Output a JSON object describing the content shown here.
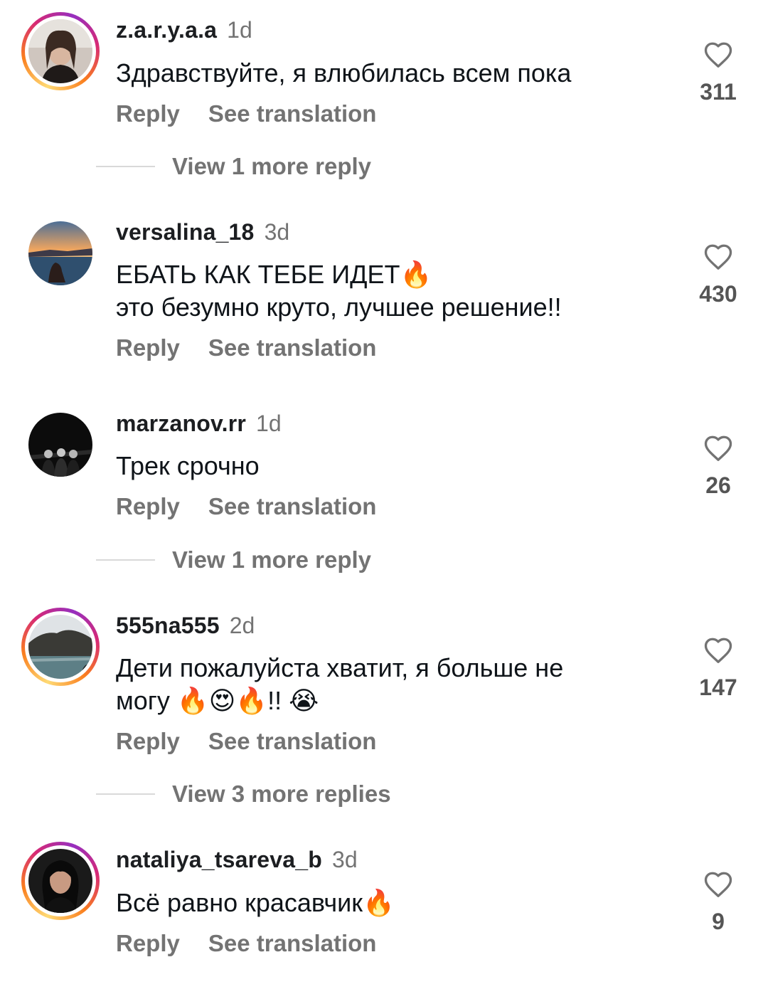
{
  "comments": [
    {
      "username": "z.a.r.y.a.a",
      "time": "1d",
      "lines": [
        "Здравствуйте, я влюбилась всем пока"
      ],
      "reply_label": "Reply",
      "translate_label": "See translation",
      "likes": "311",
      "view_more": "View 1 more reply"
    },
    {
      "username": "versalina_18",
      "time": "3d",
      "lines": [
        "ЕБАТЬ КАК ТЕБЕ ИДЕТ🔥",
        "это безумно круто, лучшее решение!!"
      ],
      "reply_label": "Reply",
      "translate_label": "See translation",
      "likes": "430"
    },
    {
      "username": "marzanov.rr",
      "time": "1d",
      "lines": [
        "Трек срочно"
      ],
      "reply_label": "Reply",
      "translate_label": "See translation",
      "likes": "26",
      "view_more": "View 1 more reply"
    },
    {
      "username": "555na555",
      "time": "2d",
      "lines": [
        "Дети пожалуйста хватит, я больше не",
        "могу 🔥😍🔥!! 😭"
      ],
      "reply_label": "Reply",
      "translate_label": "See translation",
      "likes": "147",
      "view_more": "View 3 more replies"
    },
    {
      "username": "nataliya_tsareva_b",
      "time": "3d",
      "lines": [
        "Всё равно красавчик🔥"
      ],
      "reply_label": "Reply",
      "translate_label": "See translation",
      "likes": "9"
    }
  ],
  "icons": {
    "like": "heart-outline-icon"
  },
  "colors": {
    "text": "#0f1419",
    "secondary": "#737373",
    "story_ring": "#d62976"
  }
}
